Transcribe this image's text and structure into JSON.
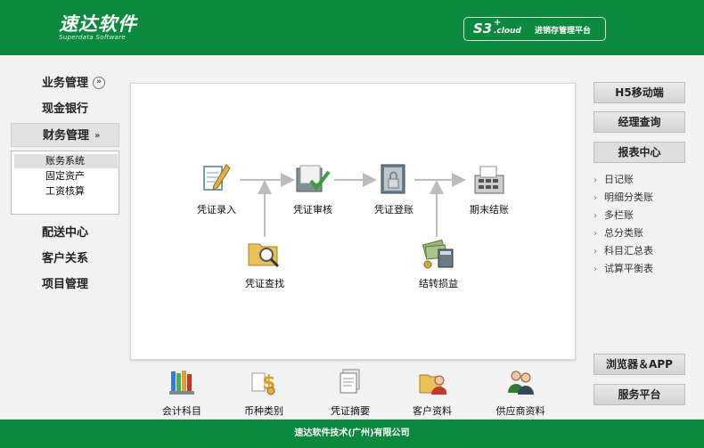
{
  "header": {
    "logo_main": "速达软件",
    "logo_sub": "Superdata Software",
    "product_s3": "S3",
    "product_plus": "+",
    "product_cloud": ".cloud",
    "product_title": "进销存管理平台"
  },
  "left_nav": {
    "items": [
      {
        "label": "业务管理"
      },
      {
        "label": "现金银行"
      },
      {
        "label": "财务管理"
      },
      {
        "label": "配送中心"
      },
      {
        "label": "客户关系"
      },
      {
        "label": "项目管理"
      }
    ],
    "expand_icons": [
      "double-chevron-circle-icon",
      "double-chevron-icon"
    ],
    "submenu": [
      {
        "label": "账务系统",
        "selected": true
      },
      {
        "label": "固定资产",
        "selected": false
      },
      {
        "label": "工资核算",
        "selected": false
      }
    ]
  },
  "flow": {
    "nodes": [
      {
        "label": "凭证录入",
        "icon": "pen-document-icon"
      },
      {
        "label": "凭证审核",
        "icon": "folder-check-icon"
      },
      {
        "label": "凭证登账",
        "icon": "binder-lock-icon"
      },
      {
        "label": "期末结账",
        "icon": "calculator-printer-icon"
      },
      {
        "label": "凭证查找",
        "icon": "folder-search-icon"
      },
      {
        "label": "结转损益",
        "icon": "money-calculator-icon"
      }
    ],
    "arrow_color": "#bdbdbd"
  },
  "bottom_bar": {
    "items": [
      {
        "label": "会计科目",
        "icon": "book-stack-icon"
      },
      {
        "label": "币种类别",
        "icon": "dollar-coins-icon"
      },
      {
        "label": "凭证摘要",
        "icon": "document-stack-icon"
      },
      {
        "label": "客户资料",
        "icon": "folder-person-icon"
      },
      {
        "label": "供应商资料",
        "icon": "two-people-icon"
      }
    ]
  },
  "right_panel": {
    "h5": "H5移动端",
    "manager": "经理查询",
    "report_center": "报表中心",
    "reports": [
      {
        "label": "日记账"
      },
      {
        "label": "明细分类账"
      },
      {
        "label": "多栏账"
      },
      {
        "label": "总分类账"
      },
      {
        "label": "科目汇总表"
      },
      {
        "label": "试算平衡表"
      }
    ],
    "browser_app": "浏览器＆APP",
    "service": "服务平台"
  },
  "footer": {
    "text": "速达软件技术(广州)有限公司"
  },
  "colors": {
    "brand_green": "#0b8a3d",
    "button_gray": "#d9d9d9"
  }
}
